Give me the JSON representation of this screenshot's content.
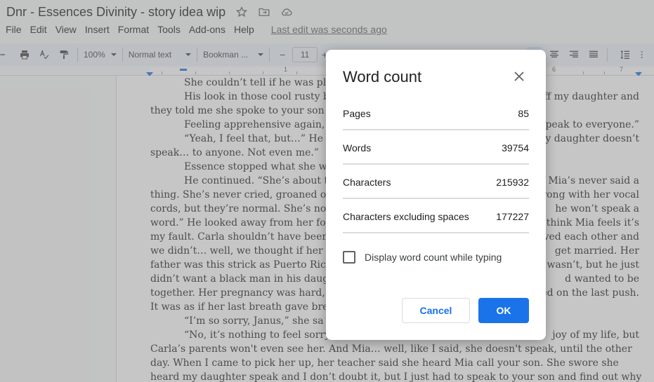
{
  "app": {
    "doc_title": "Dnr - Essences Divinity - story idea wip",
    "last_edit": "Last edit was seconds ago"
  },
  "menu": {
    "items": [
      "File",
      "Edit",
      "View",
      "Insert",
      "Format",
      "Tools",
      "Add-ons",
      "Help"
    ]
  },
  "toolbar": {
    "zoom": "100%",
    "style": "Normal text",
    "font": "Bookman ...",
    "minus": "−",
    "font_size": "11",
    "plus": "+"
  },
  "ruler": {
    "marks": [
      "1",
      "6",
      "7"
    ]
  },
  "document": {
    "lines": [
      {
        "text": "She couldn’t tell if he was pl",
        "indent": true
      },
      {
        "text": "His look in those cool rusty b",
        "indent": true,
        "right": "g off my daughter and"
      },
      {
        "text": "they told me she spoke to your son",
        "indent": false
      },
      {
        "text": "Feeling apprehensive again,",
        "indent": true,
        "right": "peak to everyone.”"
      },
      {
        "text": "“Yeah, I feel that, but…” He s",
        "indent": true,
        "right": "y daughter doesn’t"
      },
      {
        "text": "speak… to anyone. Not even me.”",
        "indent": false
      },
      {
        "text": "Essence stopped what she w",
        "indent": true
      },
      {
        "text": "He continued. “She’s about t",
        "indent": true,
        "right": "rn, Mia’s never said a"
      },
      {
        "text": "thing. She’s never cried, groaned or",
        "indent": false,
        "right": "wrong with her vocal"
      },
      {
        "text": "cords, but they’re normal. She’s no",
        "indent": false,
        "right": "he won’t speak a"
      },
      {
        "text": "word.” He looked away from her for",
        "indent": false,
        "right": "I think Mia feels it’s"
      },
      {
        "text": "my fault. Carla shouldn’t have been",
        "indent": false,
        "right": "oved each other and"
      },
      {
        "text": "we didn’t… well, we thought if her p",
        "indent": false,
        "right": "get married. Her"
      },
      {
        "text": "father was this strick as Puerto Rica",
        "indent": false,
        "right": "I wasn’t, but he just"
      },
      {
        "text": "didn’t want a black man in his daug",
        "indent": false,
        "right": "d wanted to be"
      },
      {
        "text": "together. Her pregnancy was hard,",
        "indent": false,
        "right": "died on the last push."
      },
      {
        "text": "It was as if her last breath gave bre",
        "indent": false
      },
      {
        "text": "“I’m so sorry, Janus,” she sa",
        "indent": true
      },
      {
        "text": "“No, it’s nothing to feel sorry",
        "indent": true,
        "right": "joy of my life, but"
      },
      {
        "text": "Carla’s parents won't even see her. And Mia… well, like I said, she doesn't speak, until the other",
        "indent": false
      },
      {
        "text": "day. When I came to pick her up, her teacher said she heard Mia call your son. She swore she",
        "indent": false
      },
      {
        "text": "heard my daughter speak and I don’t doubt it, but I just had to speak to your son and find out why",
        "indent": false
      }
    ]
  },
  "dialog": {
    "title": "Word count",
    "stats": [
      {
        "label": "Pages",
        "value": "85"
      },
      {
        "label": "Words",
        "value": "39754"
      },
      {
        "label": "Characters",
        "value": "215932"
      },
      {
        "label": "Characters excluding spaces",
        "value": "177227"
      }
    ],
    "checkbox_label": "Display word count while typing",
    "checkbox_checked": false,
    "cancel_label": "Cancel",
    "ok_label": "OK",
    "accent_color": "#1a73e8"
  }
}
